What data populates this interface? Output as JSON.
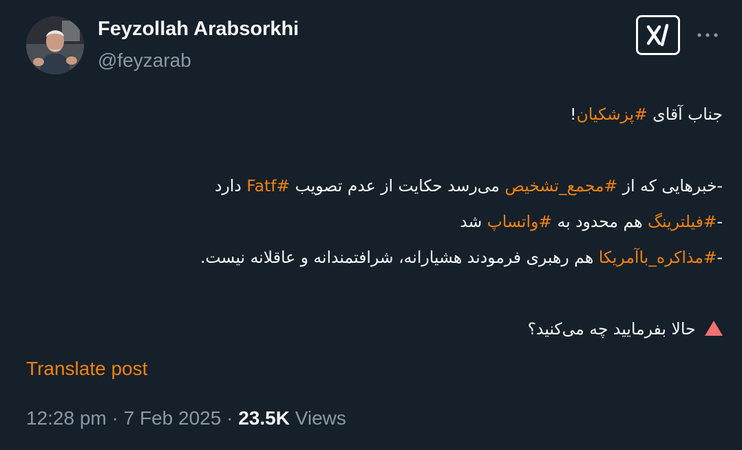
{
  "author": {
    "name": "Feyzollah Arabsorkhi",
    "handle": "@feyzarab"
  },
  "header_icons": {
    "grok": "grok-icon",
    "more": "more-horizontal-icon"
  },
  "post": {
    "lines": [
      [
        {
          "t": "جناب آقای "
        },
        {
          "t": "#پزشکیان",
          "tag": true
        },
        {
          "t": "!"
        }
      ],
      [],
      [
        {
          "t": "-خبرهایی که از "
        },
        {
          "t": "#مجمع_تشخیص",
          "tag": true
        },
        {
          "t": " می‌رسد حکایت از عدم تصویب "
        },
        {
          "t": "#Fatf",
          "tag": true
        },
        {
          "t": " دارد"
        }
      ],
      [
        {
          "t": "-"
        },
        {
          "t": "#فیلترینگ",
          "tag": true
        },
        {
          "t": " هم محدود به "
        },
        {
          "t": "#واتساپ",
          "tag": true
        },
        {
          "t": " شد"
        }
      ],
      [
        {
          "t": "-"
        },
        {
          "t": "#مذاکره_باآمریکا",
          "tag": true
        },
        {
          "t": " هم رهبری فرمودند هشیارانه، شرافتمندانه و عاقلانه نیست."
        }
      ],
      [],
      [
        {
          "icon": "red-triangle-icon"
        },
        {
          "t": " حالا بفرمایید چه می‌کنید؟"
        }
      ]
    ]
  },
  "translate_label": "Translate post",
  "meta": {
    "time": "12:28 pm",
    "separator": "·",
    "date": "7 Feb 2025",
    "views_count": "23.5K",
    "views_label": "Views"
  },
  "colors": {
    "background": "#15202b",
    "text": "#f7f9f9",
    "secondary": "#8b98a5",
    "accent": "#f0820f",
    "triangle": "#f2716f"
  }
}
